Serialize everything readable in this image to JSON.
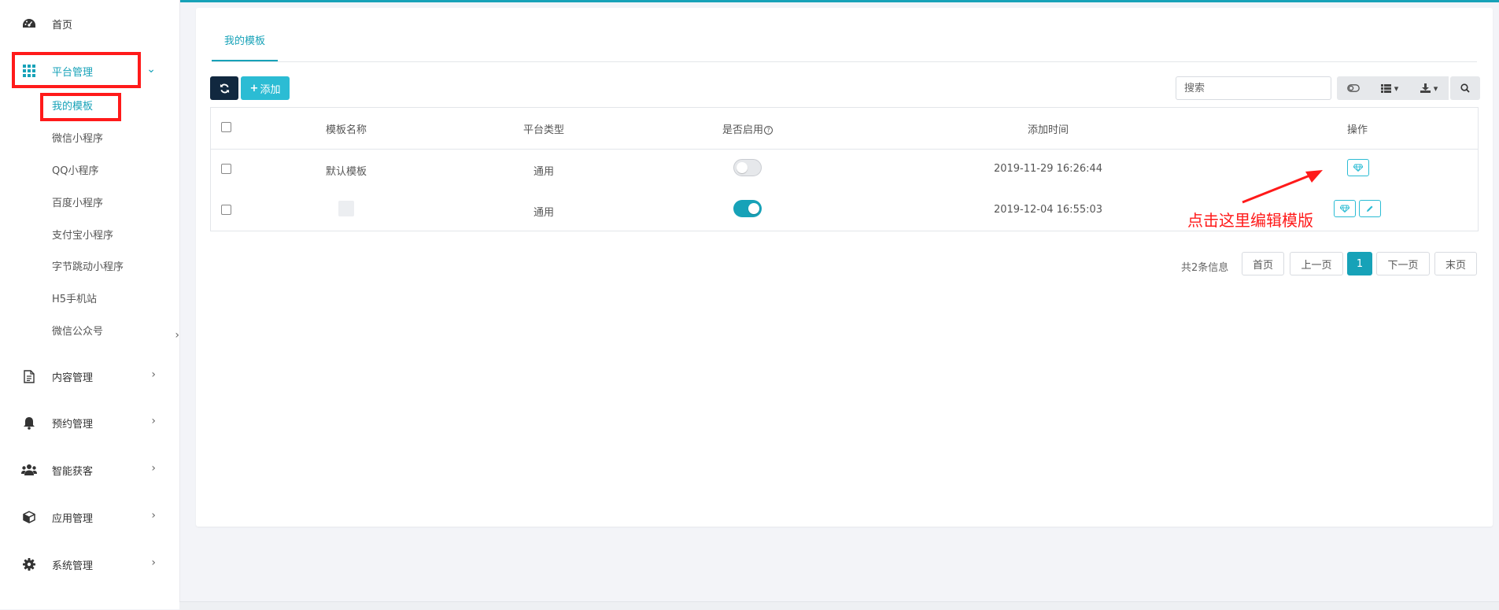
{
  "sidebar": {
    "home": "首页",
    "platform": "平台管理",
    "platform_sub": [
      "我的模板",
      "微信小程序",
      "QQ小程序",
      "百度小程序",
      "支付宝小程序",
      "字节跳动小程序",
      "H5手机站",
      "微信公众号"
    ],
    "content": "内容管理",
    "booking": "预约管理",
    "customers": "智能获客",
    "apps": "应用管理",
    "system": "系统管理"
  },
  "main": {
    "tab": "我的模板",
    "add_label": "添加",
    "search_placeholder": "搜索",
    "table": {
      "headers": [
        "模板名称",
        "平台类型",
        "是否启用",
        "添加时间",
        "操作"
      ],
      "rows": [
        {
          "name": "默认模板",
          "platform": "通用",
          "enabled": false,
          "time": "2019-11-29 16:26:44"
        },
        {
          "name": "",
          "platform": "通用",
          "enabled": true,
          "time": "2019-12-04 16:55:03"
        }
      ]
    },
    "pagination": {
      "total": "共2条信息",
      "first": "首页",
      "prev": "上一页",
      "current": "1",
      "next": "下一页",
      "last": "末页"
    },
    "annotation": "点击这里编辑模版"
  },
  "colors": {
    "accent": "#17a2b8",
    "annotation": "#ff1a1a",
    "dark_button": "#11283f"
  }
}
